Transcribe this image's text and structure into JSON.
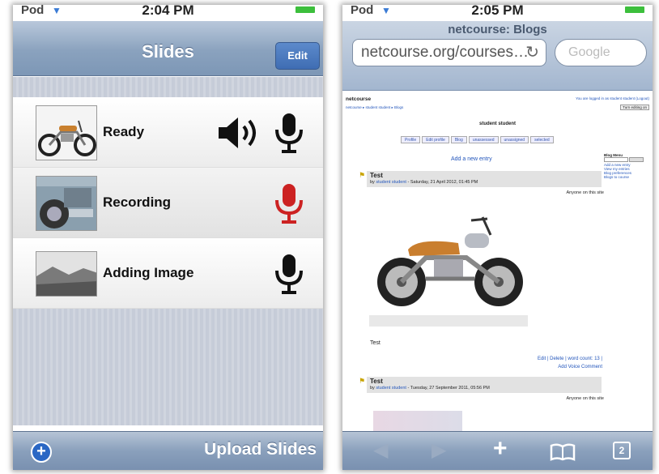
{
  "left_screen": {
    "status": {
      "carrier": "Pod",
      "time": "2:04 PM"
    },
    "nav": {
      "title": "Slides",
      "edit_label": "Edit"
    },
    "slides": [
      {
        "label": "Ready",
        "mic_color": "#111111",
        "has_speaker": true
      },
      {
        "label": "Recording",
        "mic_color": "#cc2222",
        "has_speaker": false
      },
      {
        "label": "Adding Image",
        "mic_color": "#111111",
        "has_speaker": false
      }
    ],
    "toolbar": {
      "add_icon": "plus-circle-icon",
      "upload_label": "Upload Slides"
    }
  },
  "right_screen": {
    "status": {
      "carrier": "Pod",
      "time": "2:05 PM"
    },
    "page_title": "netcourse: Blogs",
    "url": "netcourse.org/courses…",
    "search_placeholder": "Google",
    "webpage": {
      "site_name": "netcourse",
      "logged_in": "You are logged in as student student (Logout)",
      "breadcrumb": "netcourse ▸ student student ▸ Blogs",
      "turn_editing": "Turn editing on",
      "user_heading": "student student",
      "tabs": [
        "Profile",
        "Edit profile",
        "Blog",
        "unassessed",
        "unassigned",
        "selected"
      ],
      "add_entry": "Add a new entry",
      "sidebar": {
        "title": "Blog Menu",
        "search_btn": "Search",
        "links": [
          "Add a new entry",
          "View my entries",
          "Blog preferences",
          "Blogs to course"
        ]
      },
      "posts": [
        {
          "title": "Test",
          "by_prefix": "by",
          "author": "student student",
          "date": " - Saturday, 21 April 2012, 01:45 PM",
          "visibility": "Anyone on this site",
          "body": "Test",
          "actions": "Edit | Delete | word count: 13 |",
          "voice_comment": "Add Voice Comment"
        },
        {
          "title": "Test",
          "by_prefix": "by",
          "author": "student student",
          "date": " - Tuesday, 27 September 2011, 05:56 PM",
          "visibility": "Anyone on this site"
        }
      ]
    },
    "toolbar": {
      "back_icon": "back-arrow-icon",
      "forward_icon": "forward-arrow-icon",
      "add_icon": "plus-icon",
      "bookmarks_icon": "bookmarks-icon",
      "pages_icon": "pages-icon",
      "pages_count": "2"
    }
  }
}
